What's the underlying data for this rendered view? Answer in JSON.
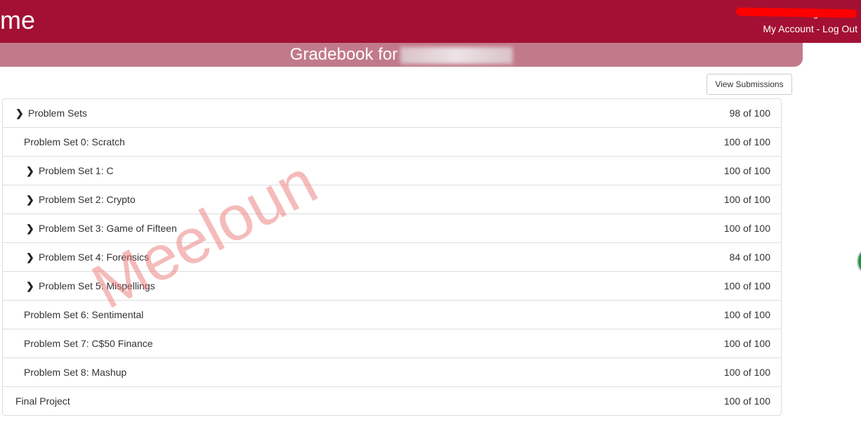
{
  "header": {
    "logo": "me",
    "signed_in": "Signed in as",
    "my_account": "My Account",
    "separator": " - ",
    "log_out": "Log Out"
  },
  "banner": {
    "title": "Gradebook for"
  },
  "toolbar": {
    "view_submissions": "View Submissions"
  },
  "rows": [
    {
      "label": "Problem Sets",
      "score": "98 of 100",
      "expandable": true,
      "level": 0
    },
    {
      "label": "Problem Set 0: Scratch",
      "score": "100 of 100",
      "expandable": false,
      "level": 1
    },
    {
      "label": "Problem Set 1: C",
      "score": "100 of 100",
      "expandable": true,
      "level": 1
    },
    {
      "label": "Problem Set 2: Crypto",
      "score": "100 of 100",
      "expandable": true,
      "level": 1
    },
    {
      "label": "Problem Set 3: Game of Fifteen",
      "score": "100 of 100",
      "expandable": true,
      "level": 1
    },
    {
      "label": "Problem Set 4: Forensics",
      "score": "84 of 100",
      "expandable": true,
      "level": 1
    },
    {
      "label": "Problem Set 5: Mispellings",
      "score": "100 of 100",
      "expandable": true,
      "level": 1
    },
    {
      "label": "Problem Set 6: Sentimental",
      "score": "100 of 100",
      "expandable": false,
      "level": 1
    },
    {
      "label": "Problem Set 7: C$50 Finance",
      "score": "100 of 100",
      "expandable": false,
      "level": 1
    },
    {
      "label": "Problem Set 8: Mashup",
      "score": "100 of 100",
      "expandable": false,
      "level": 1
    },
    {
      "label": "Final Project",
      "score": "100 of 100",
      "expandable": false,
      "level": 0
    }
  ],
  "watermark": "Meeloun",
  "colors": {
    "brand": "#a31034",
    "banner": "#c17a8a"
  }
}
